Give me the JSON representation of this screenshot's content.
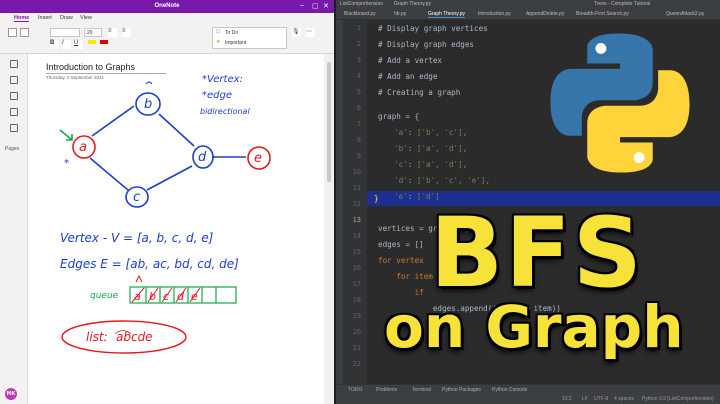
{
  "onenote": {
    "window_title": "OneNote",
    "tabs": [
      "Home",
      "Insert",
      "Draw",
      "View"
    ],
    "ribbon": {
      "font_size": "20",
      "tags": [
        "To Do",
        "Important"
      ]
    },
    "rail_label": "Pages",
    "avatar_initials": "MK",
    "page": {
      "title": "Introduction to Graphs",
      "date": "Thursday, 2 September 2021"
    },
    "ink": {
      "nodes": [
        "a",
        "b",
        "c",
        "d",
        "e"
      ],
      "notes": [
        "*Vertex:",
        "*edge",
        "bidirectional"
      ],
      "vertex_line": "Vertex - V = [a, b, c, d, e]",
      "edges_line": "Edges  E = [ab, ac, bd, cd, de]",
      "queue_label": "queue",
      "queue_cells": [
        "a",
        "b",
        "c",
        "d",
        "e"
      ],
      "list_label": "list:",
      "list_value": "abcde"
    }
  },
  "ide": {
    "project": "ListComprehension",
    "file": "Graph Theory.py",
    "run_config": "Trees - Complete Tutorial",
    "tabs": [
      "Blackboard.py",
      "hb.py",
      "Graph Theory.py",
      "Introduction.py",
      "AppendDelete.py",
      "Breadth-First Search.py",
      "QueenAttack2.py"
    ],
    "active_tab": "Graph Theory.py",
    "line_numbers": [
      "1",
      "2",
      "3",
      "4",
      "5",
      "6",
      "7",
      "8",
      "9",
      "10",
      "11",
      "12",
      "13",
      "14",
      "15",
      "16",
      "17",
      "18",
      "19",
      "20",
      "21",
      "22"
    ],
    "current_line": "13",
    "code": {
      "l1": "# Display graph vertices",
      "l2": "# Display graph edges",
      "l3": "# Add a vertex",
      "l4": "# Add an edge",
      "l5": "# Creating a graph",
      "l7_a": "graph",
      "l7_b": " = {",
      "l8_key": "'a'",
      "l8_val": "['b', 'c']",
      "l9_key": "'b'",
      "l9_val": "['a', 'd']",
      "l10_key": "'c'",
      "l10_val": "['a', 'd']",
      "l11_key": "'d'",
      "l11_val": "['b', 'c', 'e']",
      "l12_key": "'e'",
      "l12_val": "['d']",
      "l13": "}",
      "l15": "vertices = graph.keys()",
      "l16": "edges = []",
      "l18": "for vertex",
      "l19": "    for item",
      "l19_end": "j:",
      "l20": "        if",
      "l21": "            edges.append((vertex, item))"
    },
    "status_left": [
      "TODO",
      "Problems",
      "Terminal",
      "Python Packages",
      "Python Console"
    ],
    "status_right": [
      "13:2",
      "LF",
      "UTF-8",
      "4 spaces",
      "Python 3.9 (ListComprehension)"
    ]
  },
  "overlay": {
    "title": "BFS",
    "subtitle": "on Graph"
  },
  "colors": {
    "onenote_purple": "#7719aa",
    "ink_blue": "#1a3fc7",
    "ink_red": "#e0191e",
    "ink_green": "#15a84a",
    "title_yellow": "#f7e23a",
    "python_blue": "#3776ab",
    "python_yellow": "#ffd43b"
  }
}
